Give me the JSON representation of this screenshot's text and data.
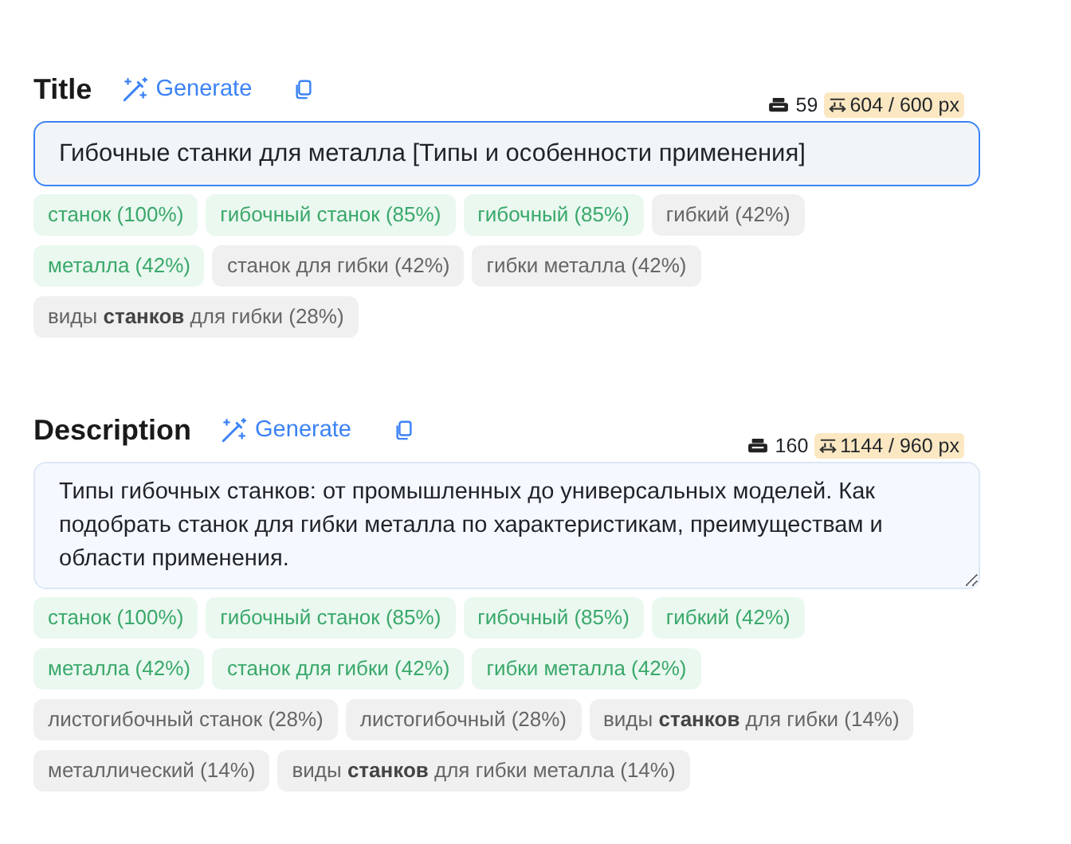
{
  "sections": [
    {
      "kind": "input",
      "label": "Title",
      "generate": "Generate",
      "chars": "59",
      "width": "604 / 600 px",
      "over": true,
      "focused": true,
      "value": "Гибочные станки для металла [Типы и особенности применения]",
      "keywords": [
        {
          "text": "станок (100%)",
          "matched": true
        },
        {
          "text": "гибочный станок (85%)",
          "matched": true
        },
        {
          "text": "гибочный (85%)",
          "matched": true
        },
        {
          "text": "гибкий (42%)",
          "matched": false
        },
        {
          "text": "металла (42%)",
          "matched": true
        },
        {
          "text": "станок для гибки (42%)",
          "matched": false
        },
        {
          "text": "гибки металла (42%)",
          "matched": false
        },
        {
          "text": "виды **станков** для гибки (28%)",
          "matched": false
        }
      ]
    },
    {
      "kind": "textarea",
      "label": "Description",
      "generate": "Generate",
      "chars": "160",
      "width": "1144 / 960 px",
      "over": true,
      "focused": false,
      "value": "Типы гибочных станков: от промышленных до универсальных моделей. Как подобрать станок для гибки металла по характеристикам, преимуществам и области применения.",
      "keywords": [
        {
          "text": "станок (100%)",
          "matched": true
        },
        {
          "text": "гибочный станок (85%)",
          "matched": true
        },
        {
          "text": "гибочный (85%)",
          "matched": true
        },
        {
          "text": "гибкий (42%)",
          "matched": true
        },
        {
          "text": "металла (42%)",
          "matched": true
        },
        {
          "text": "станок для гибки (42%)",
          "matched": true
        },
        {
          "text": "гибки металла (42%)",
          "matched": true
        },
        {
          "text": "листогибочный станок (28%)",
          "matched": false
        },
        {
          "text": "листогибочный (28%)",
          "matched": false
        },
        {
          "text": "виды **станков** для гибки (14%)",
          "matched": false
        },
        {
          "text": "металлический (14%)",
          "matched": false
        },
        {
          "text": "виды **станков** для гибки металла (14%)",
          "matched": false
        }
      ]
    }
  ]
}
